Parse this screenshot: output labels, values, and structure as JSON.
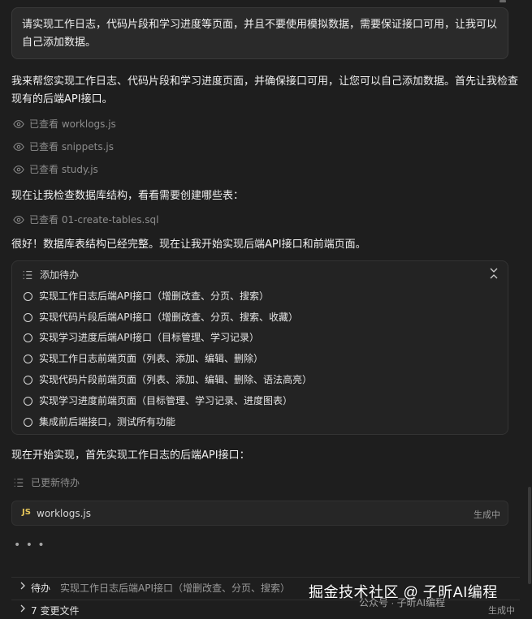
{
  "user_prompt": "请实现工作日志，代码片段和学习进度等页面，并且不要使用模拟数据，需要保证接口可用，让我可以自己添加数据。",
  "assistant": {
    "intro": "我来帮您实现工作日志、代码片段和学习进度页面，并确保接口可用，让您可以自己添加数据。首先让我检查现有的后端API接口。",
    "viewed_files": [
      "已查看 worklogs.js",
      "已查看 snippets.js",
      "已查看 study.js"
    ],
    "db_check": "现在让我检查数据库结构，看看需要创建哪些表：",
    "viewed_sql": "已查看 01-create-tables.sql",
    "db_good": "很好！数据库表结构已经完整。现在让我开始实现后端API接口和前端页面。",
    "todo_card": {
      "title": "添加待办",
      "items": [
        "实现工作日志后端API接口（增删改查、分页、搜索）",
        "实现代码片段后端API接口（增删改查、分页、搜索、收藏）",
        "实现学习进度后端API接口（目标管理、学习记录）",
        "实现工作日志前端页面（列表、添加、编辑、删除）",
        "实现代码片段前端页面（列表、添加、编辑、删除、语法高亮）",
        "实现学习进度前端页面（目标管理、学习记录、进度图表）",
        "集成前后端接口，测试所有功能"
      ]
    },
    "start_impl": "现在开始实现，首先实现工作日志的后端API接口：",
    "updated_todo": "已更新待办",
    "file_card": {
      "badge": "JS",
      "name": "worklogs.js",
      "status": "生成中"
    },
    "dots": "• • •"
  },
  "bottom": {
    "todo_row": {
      "label": "待办",
      "desc": "实现工作日志后端API接口（增删改查、分页、搜索）"
    },
    "changes_row": {
      "label": "7 变更文件",
      "status": "生成中"
    }
  },
  "watermark": {
    "main": "掘金技术社区 @ 子昕AI编程",
    "sub": "公众号 · 子昕AI编程"
  },
  "colors": {
    "background": "#1e1e1e",
    "card": "#232323",
    "js_badge": "#e7c75a",
    "muted": "#8d8d8d"
  }
}
